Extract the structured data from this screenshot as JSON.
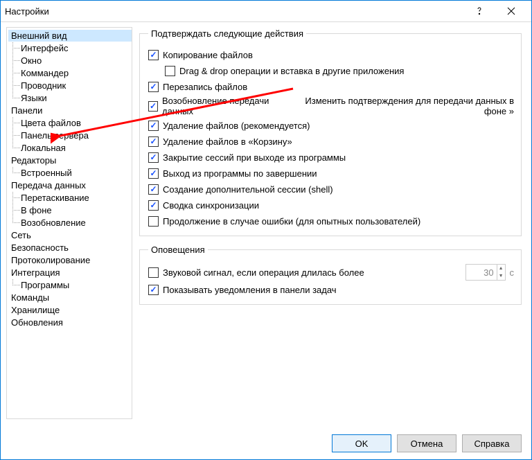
{
  "window": {
    "title": "Настройки"
  },
  "tree": {
    "items": [
      {
        "label": "Внешний вид",
        "selected": true,
        "children": [
          "Интерфейс",
          "Окно",
          "Коммандер",
          "Проводник",
          "Языки"
        ]
      },
      {
        "label": "Панели",
        "children": [
          "Цвета файлов",
          "Панель сервера",
          "Локальная"
        ]
      },
      {
        "label": "Редакторы",
        "children": [
          "Встроенный"
        ]
      },
      {
        "label": "Передача данных",
        "children": [
          "Перетаскивание",
          "В фоне",
          "Возобновление"
        ]
      },
      {
        "label": "Сеть",
        "children": []
      },
      {
        "label": "Безопасность",
        "children": []
      },
      {
        "label": "Протоколирование",
        "children": []
      },
      {
        "label": "Интеграция",
        "children": [
          "Программы"
        ]
      },
      {
        "label": "Команды",
        "children": []
      },
      {
        "label": "Хранилище",
        "children": []
      },
      {
        "label": "Обновления",
        "children": []
      }
    ]
  },
  "groups": {
    "confirm": {
      "legend": "Подтверждать следующие действия",
      "link": "Изменить подтверждения для передачи данных в фоне »",
      "items": [
        {
          "label": "Копирование файлов",
          "checked": true,
          "indent": 0
        },
        {
          "label": "Drag & drop операции и вставка в другие приложения",
          "checked": false,
          "indent": 1
        },
        {
          "label": "Перезапись файлов",
          "checked": true,
          "indent": 0
        },
        {
          "label": "Возобновление передачи данных",
          "checked": true,
          "indent": 0,
          "link": true
        },
        {
          "label": "Удаление файлов (рекомендуется)",
          "checked": true,
          "indent": 0
        },
        {
          "label": "Удаление файлов в «Корзину»",
          "checked": true,
          "indent": 0
        },
        {
          "label": "Закрытие сессий при выходе из программы",
          "checked": true,
          "indent": 0
        },
        {
          "label": "Выход из программы по завершении",
          "checked": true,
          "indent": 0
        },
        {
          "label": "Создание дополнительной сессии (shell)",
          "checked": true,
          "indent": 0
        },
        {
          "label": "Сводка синхронизации",
          "checked": true,
          "indent": 0
        },
        {
          "label": "Продолжение в случае ошибки (для опытных пользователей)",
          "checked": false,
          "indent": 0
        }
      ]
    },
    "notify": {
      "legend": "Оповещения",
      "beep": {
        "label": "Звуковой сигнал, если операция длилась более",
        "checked": false,
        "seconds": "30",
        "unit": "с"
      },
      "taskbar": {
        "label": "Показывать уведомления в панели задач",
        "checked": true
      }
    }
  },
  "buttons": {
    "ok": "OK",
    "cancel": "Отмена",
    "help": "Справка"
  }
}
